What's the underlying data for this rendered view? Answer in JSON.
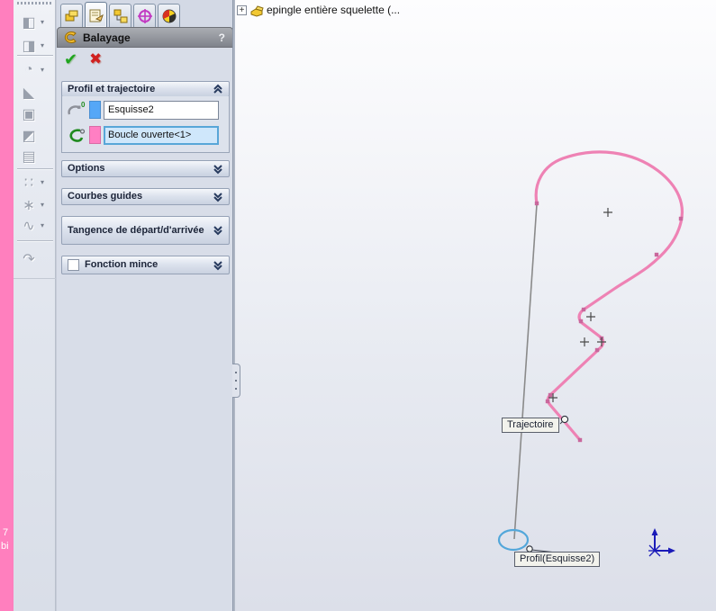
{
  "background_window": {
    "text_fragments": [
      "7",
      "bi"
    ]
  },
  "features_toolbar": {
    "items": [
      {
        "name": "boss-extrude",
        "glyph": "◧",
        "dropdown": true
      },
      {
        "name": "cut-extrude",
        "glyph": "◨",
        "dropdown": true
      },
      {
        "name": "fillet",
        "glyph": "◔",
        "dropdown": true
      },
      {
        "name": "chamfer",
        "glyph": "◣",
        "dropdown": false
      },
      {
        "name": "shell",
        "glyph": "▣",
        "dropdown": false
      },
      {
        "name": "draft",
        "glyph": "◩",
        "dropdown": false
      },
      {
        "name": "rib",
        "glyph": "▤",
        "dropdown": false
      },
      {
        "name": "linear-pattern",
        "glyph": "∷",
        "dropdown": true
      },
      {
        "name": "curves",
        "glyph": "∗",
        "dropdown": true
      },
      {
        "name": "spline-tools",
        "glyph": "∿",
        "dropdown": true
      },
      {
        "name": "instant3d",
        "glyph": "↷",
        "dropdown": false
      }
    ]
  },
  "property_manager": {
    "title": "Balayage",
    "help_label": "?",
    "ok_glyph": "✔",
    "cancel_glyph": "✖",
    "sections": {
      "profile_path": {
        "title": "Profil et trajectoire",
        "profile_row": {
          "badge": "0",
          "value": "Esquisse2",
          "swatch_color": "#55a7f7"
        },
        "path_row": {
          "badge": "0",
          "value": "Boucle ouverte<1>",
          "swatch_color": "#ff7fc3"
        }
      },
      "options": {
        "title": "Options"
      },
      "guide_curves": {
        "title": "Courbes guides"
      },
      "tangency": {
        "title": "Tangence de départ/d'arrivée"
      },
      "thin_feature": {
        "title": "Fonction mince",
        "checked": false
      }
    }
  },
  "viewport": {
    "tree_item": {
      "expand_glyph": "+",
      "label": "epingle entière squelette  (..."
    },
    "callouts": {
      "trajectory": "Trajectoire",
      "profile": "Profil(Esquisse2)"
    },
    "colors": {
      "path_pink": "#ee82b4",
      "marker_pink": "#c9679c",
      "sketch_gray": "#8a8a8a",
      "profile_ellipse_blue": "#53a7da",
      "triad_blue": "#1a1ab8"
    }
  }
}
